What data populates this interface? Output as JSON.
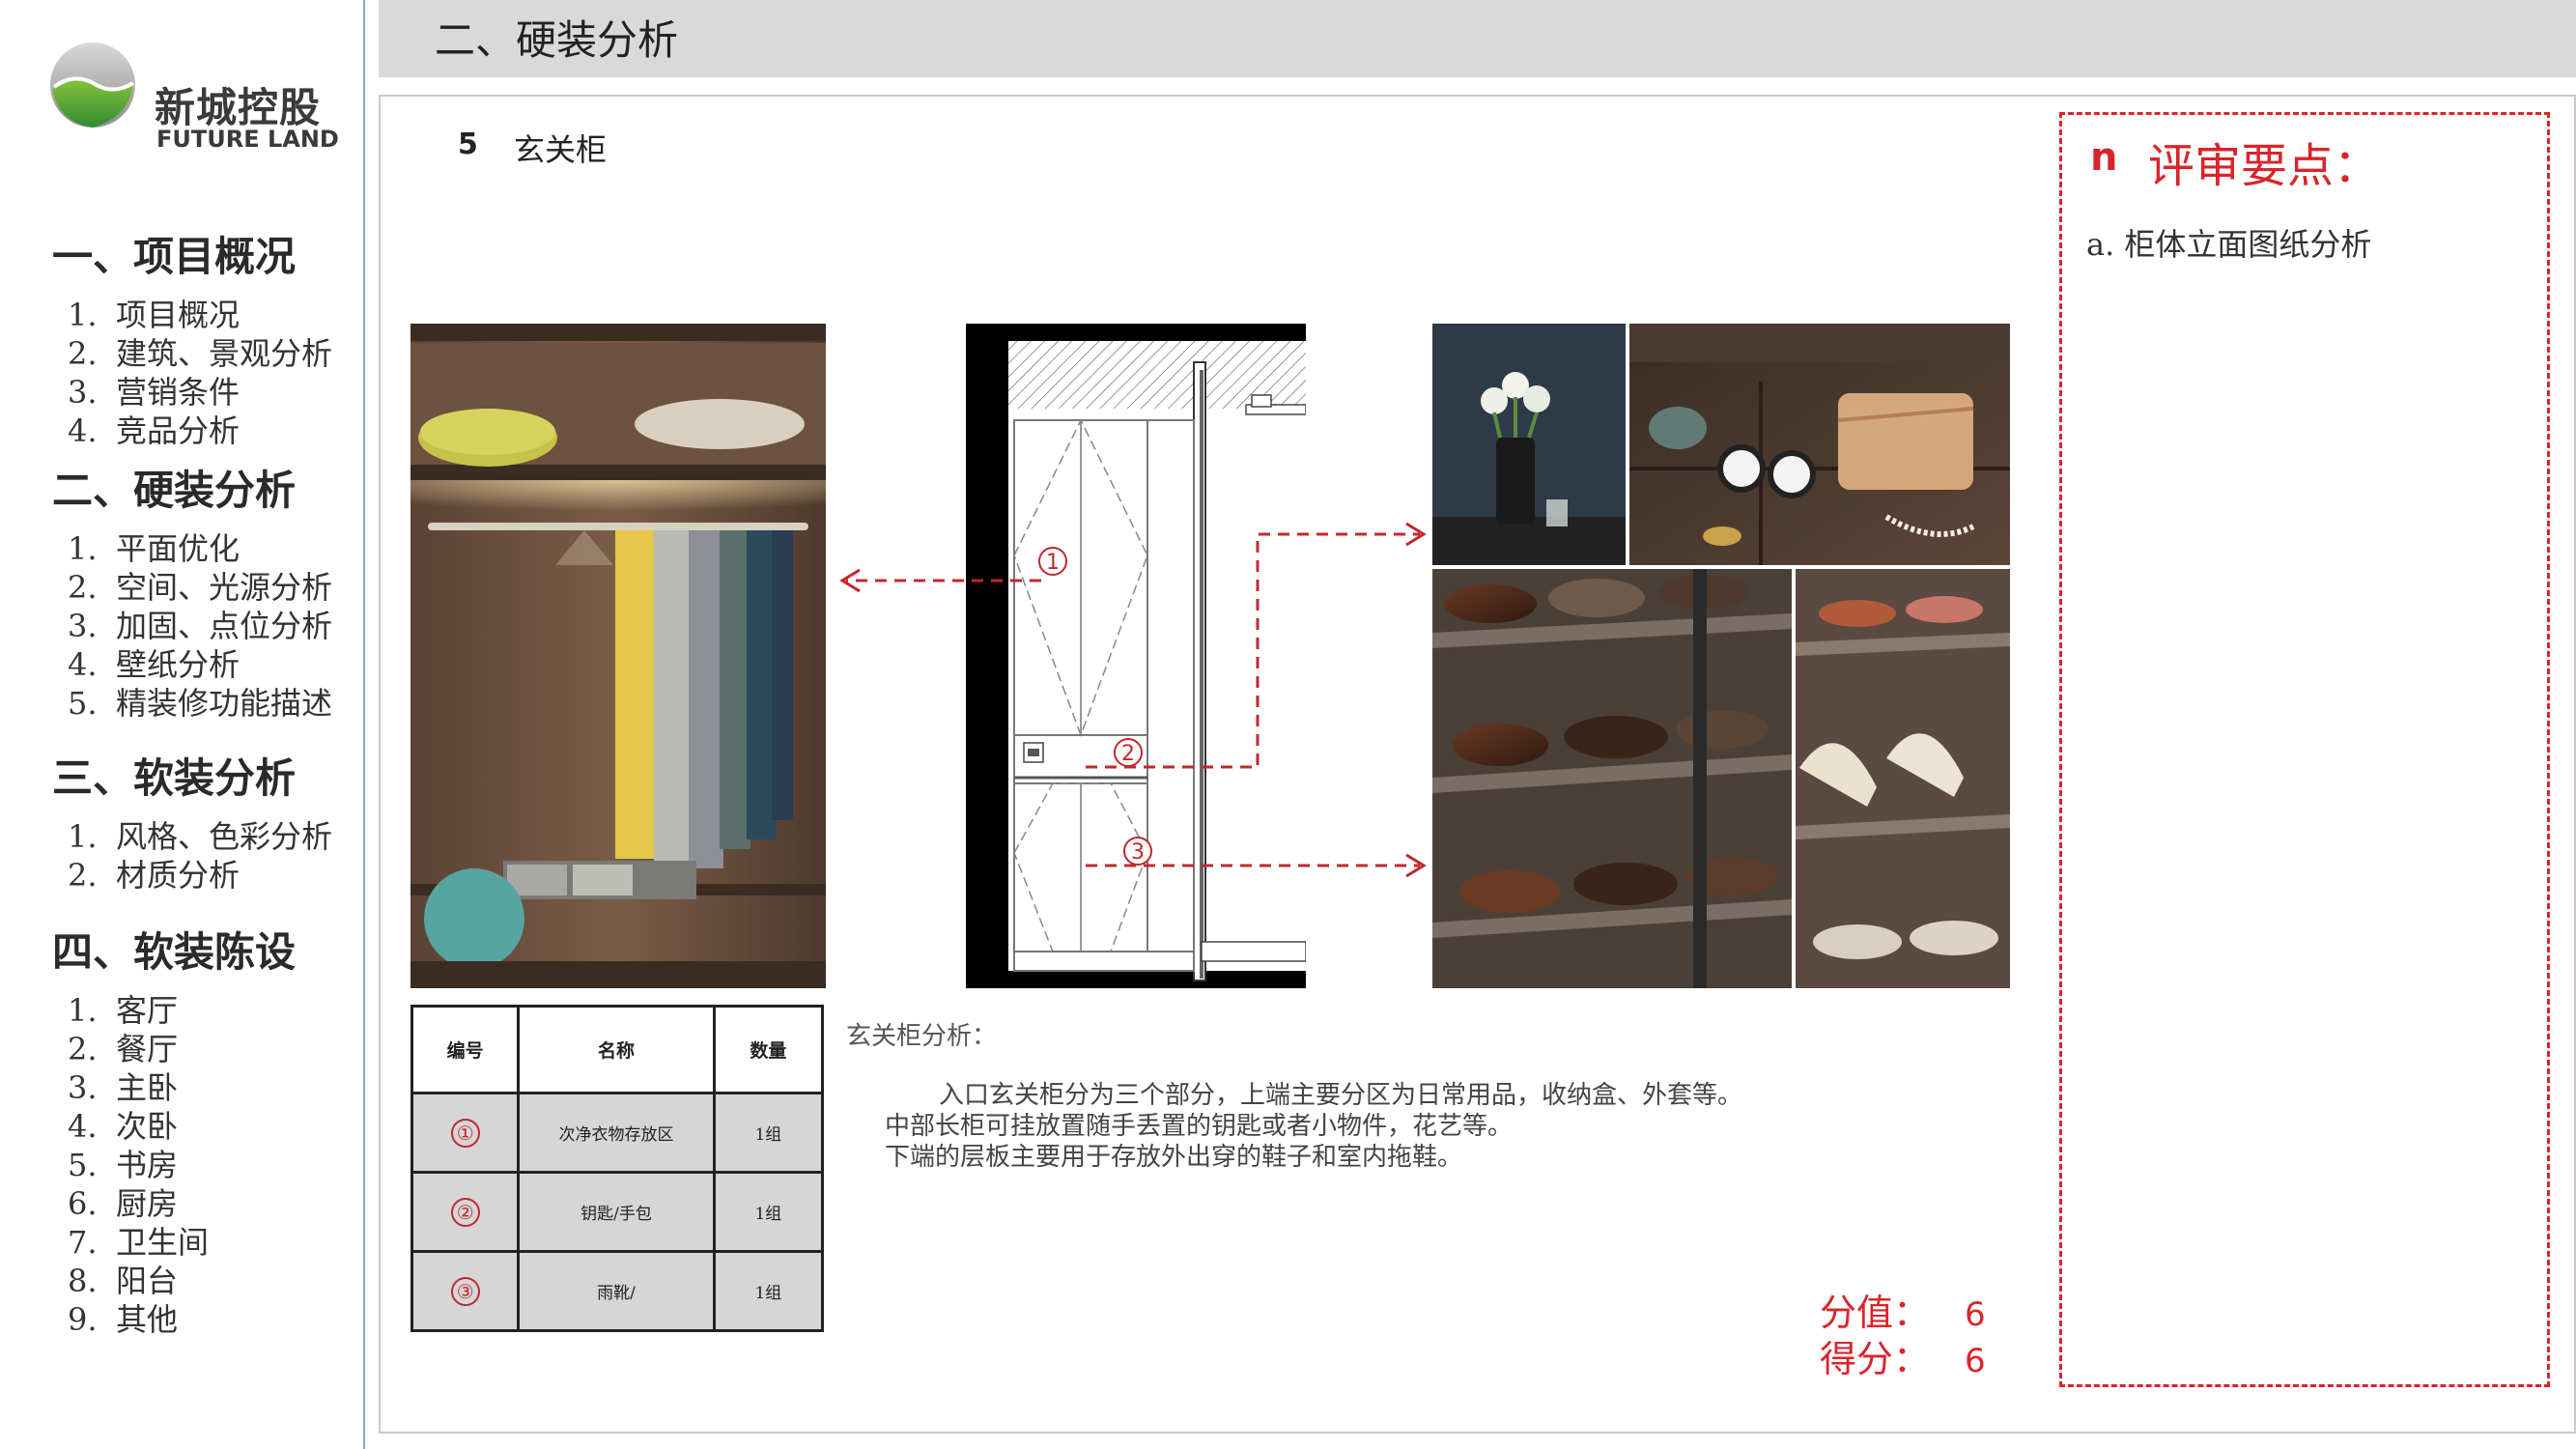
{
  "logo": {
    "name_cn": "新城控股",
    "name_en": "FUTURE LAND"
  },
  "sidebar": {
    "sections": [
      {
        "title": "一、项目概况",
        "items": [
          {
            "num": "1.",
            "label": "项目概况"
          },
          {
            "num": "2.",
            "label": "建筑、景观分析"
          },
          {
            "num": "3.",
            "label": "营销条件"
          },
          {
            "num": "4.",
            "label": "竞品分析"
          }
        ]
      },
      {
        "title": "二、硬装分析",
        "items": [
          {
            "num": "1.",
            "label": "平面优化"
          },
          {
            "num": "2.",
            "label": "空间、光源分析"
          },
          {
            "num": "3.",
            "label": "加固、点位分析"
          },
          {
            "num": "4.",
            "label": "壁纸分析"
          },
          {
            "num": "5.",
            "label": "精装修功能描述"
          }
        ]
      },
      {
        "title": "三、软装分析",
        "items": [
          {
            "num": "1.",
            "label": "风格、色彩分析"
          },
          {
            "num": "2.",
            "label": "材质分析"
          }
        ]
      },
      {
        "title": "四、软装陈设",
        "items": [
          {
            "num": "1.",
            "label": "客厅"
          },
          {
            "num": "2.",
            "label": "餐厅"
          },
          {
            "num": "3.",
            "label": "主卧"
          },
          {
            "num": "4.",
            "label": "次卧"
          },
          {
            "num": "5.",
            "label": "书房"
          },
          {
            "num": "6.",
            "label": "厨房"
          },
          {
            "num": "7.",
            "label": "卫生间"
          },
          {
            "num": "8.",
            "label": "阳台"
          },
          {
            "num": "9.",
            "label": "其他"
          }
        ]
      }
    ]
  },
  "header": {
    "title": "二、硬装分析"
  },
  "main": {
    "sub_number": "5",
    "sub_title": "玄关柜",
    "drawing_labels": [
      "①",
      "②",
      "③"
    ],
    "table": {
      "headers": [
        "编号",
        "名称",
        "数量"
      ],
      "rows": [
        {
          "num": "①",
          "name": "次净衣物存放区",
          "qty": "1组"
        },
        {
          "num": "②",
          "name": "钥匙/手包",
          "qty": "1组"
        },
        {
          "num": "③",
          "name": "雨靴/",
          "qty": "1组"
        }
      ]
    },
    "analysis": {
      "heading": "玄关柜分析：",
      "lines": [
        "入口玄关柜分为三个部分，上端主要分区为日常用品，收纳盒、外套等。",
        "中部长柜可挂放置随手丢置的钥匙或者小物件，花艺等。",
        "下端的层板主要用于存放外出穿的鞋子和室内拖鞋。"
      ]
    },
    "score": {
      "value_label": "分值：",
      "value": "6",
      "score_label": "得分：",
      "score": "6"
    }
  },
  "review": {
    "bullet": "n",
    "title": "评审要点：",
    "points": [
      "a. 柜体立面图纸分析"
    ]
  },
  "colors": {
    "accent_red": "#d9252a",
    "header_gray": "#d9d9d9",
    "sidebar_rule": "#8aa7cf"
  }
}
